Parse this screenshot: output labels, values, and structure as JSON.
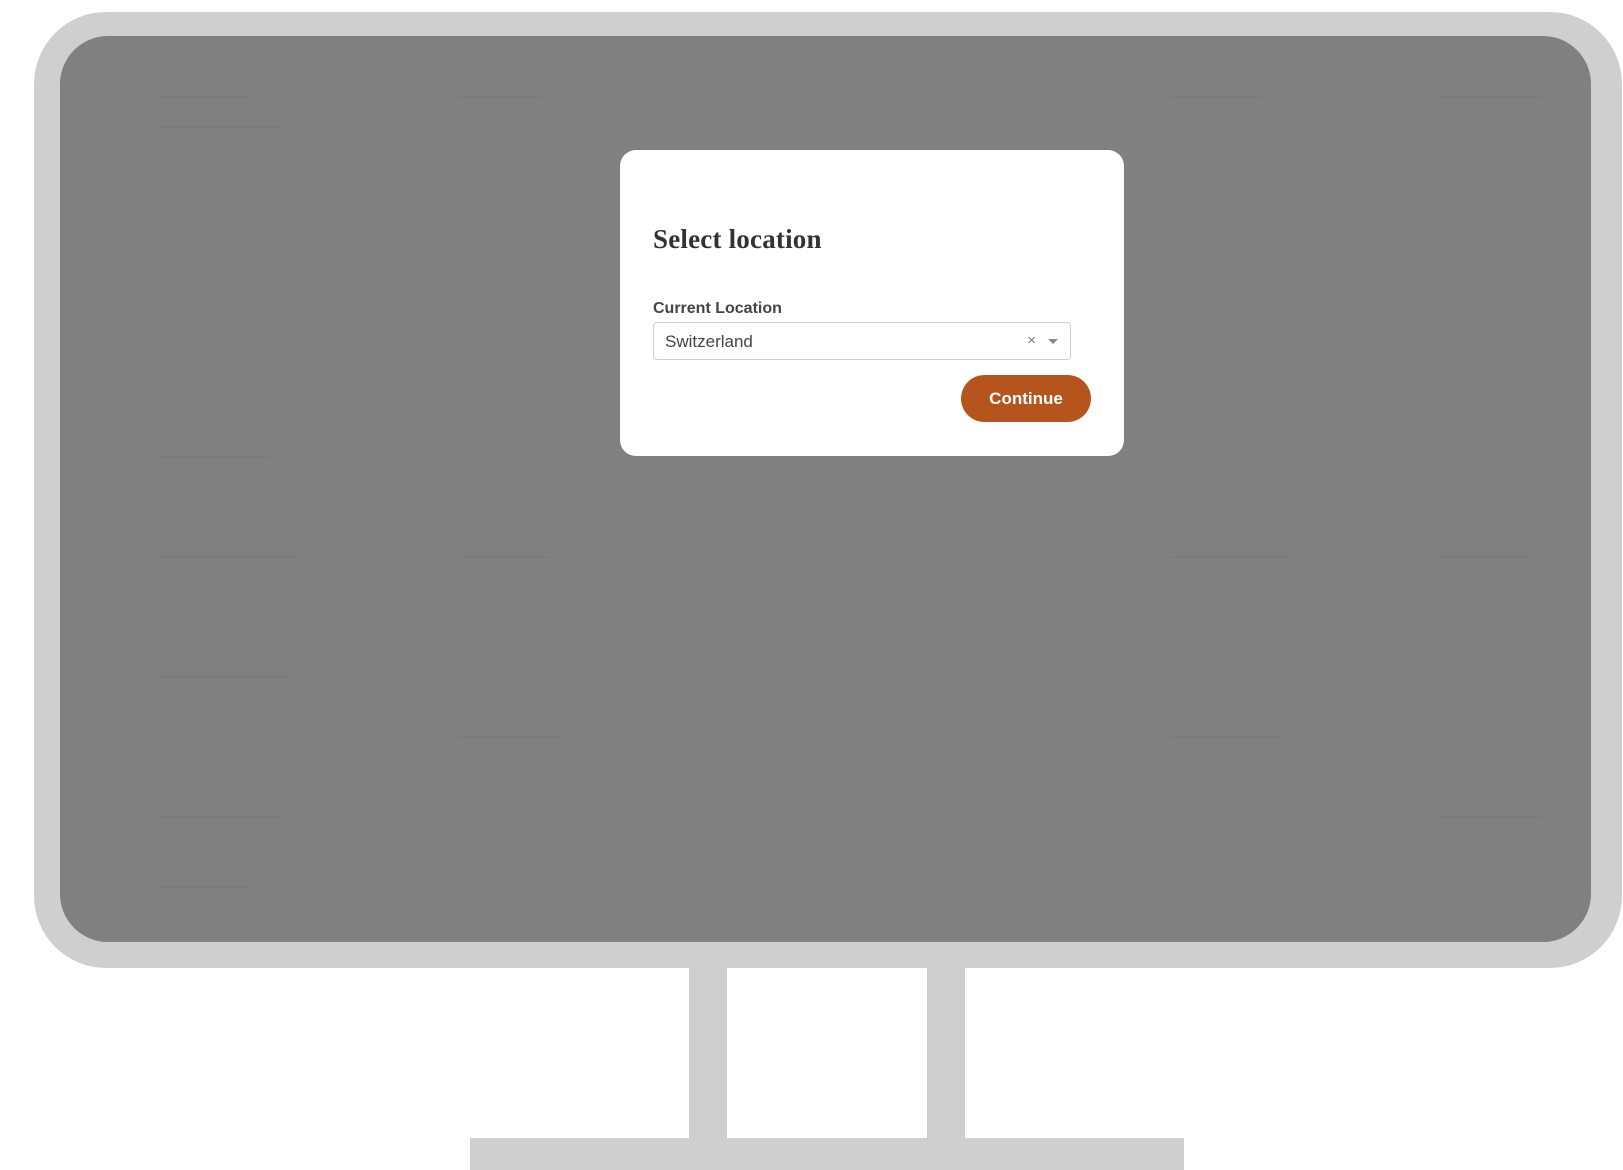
{
  "modal": {
    "title": "Select location",
    "field_label": "Current Location",
    "selected_value": "Switzerland",
    "clear_glyph": "×",
    "continue_label": "Continue"
  },
  "icons": {
    "clear": "close-icon",
    "dropdown": "chevron-down-icon"
  },
  "colors": {
    "overlay": "#808080",
    "frame": "#cfcfcf",
    "accent": "#b5541c",
    "modal_bg": "#ffffff"
  }
}
